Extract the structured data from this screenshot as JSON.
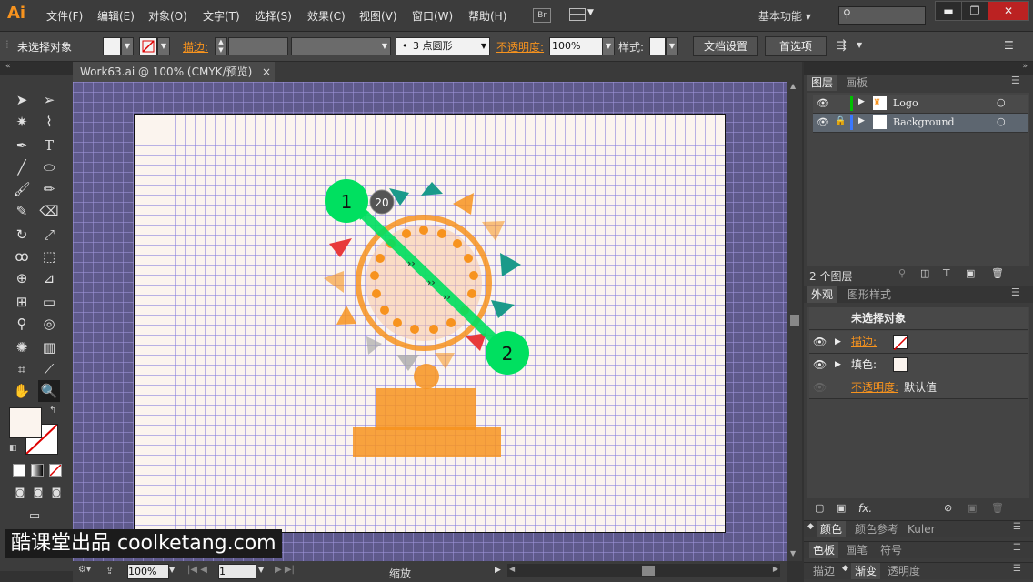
{
  "app": {
    "logo": "Ai"
  },
  "menu": [
    "文件(F)",
    "编辑(E)",
    "对象(O)",
    "文字(T)",
    "选择(S)",
    "效果(C)",
    "视图(V)",
    "窗口(W)",
    "帮助(H)"
  ],
  "menubar": {
    "bridge_label": "Br",
    "workspace": "基本功能",
    "workspace_arrow": "▾",
    "search_placeholder": "",
    "minimize": "▬",
    "maximize": "❐",
    "close": "✕"
  },
  "control": {
    "no_selection": "未选择对象",
    "stroke_label": "描边:",
    "brush": "3 点圆形",
    "opacity_label": "不透明度:",
    "opacity_value": "100%",
    "style_label": "样式:",
    "doc_setup": "文档设置",
    "prefs": "首选项"
  },
  "document_tab": {
    "title": "Work63.ai @ 100% (CMYK/预览)",
    "close": "×"
  },
  "canvas": {
    "marker1": "1",
    "marker2": "2",
    "tooltip": "20",
    "colors": {
      "pasteboard": "#5f5a8c",
      "artboard": "#fbf4ee",
      "green": "#00e060",
      "orange": "#f7931e"
    }
  },
  "status": {
    "zoom": "100%",
    "page": "1",
    "tool_name": "缩放"
  },
  "layers_panel": {
    "tabs": [
      "图层",
      "画板"
    ],
    "layers": [
      {
        "name": "Logo",
        "color": "#00c000"
      },
      {
        "name": "Background",
        "color": "#3a78ff"
      }
    ],
    "count": "2 个图层"
  },
  "appearance_panel": {
    "tabs": [
      "外观",
      "图形样式"
    ],
    "title": "未选择对象",
    "stroke_label": "描边:",
    "fill_label": "填色:",
    "opacity_label": "不透明度:",
    "opacity_value": "默认值",
    "fx": "fx."
  },
  "bottom_panels": {
    "row1": [
      "颜色",
      "颜色参考",
      "Kuler"
    ],
    "row2": [
      "色板",
      "画笔",
      "符号"
    ],
    "row3": [
      "描边",
      "渐变",
      "透明度"
    ]
  },
  "watermark": "酷课堂出品 coolketang.com"
}
